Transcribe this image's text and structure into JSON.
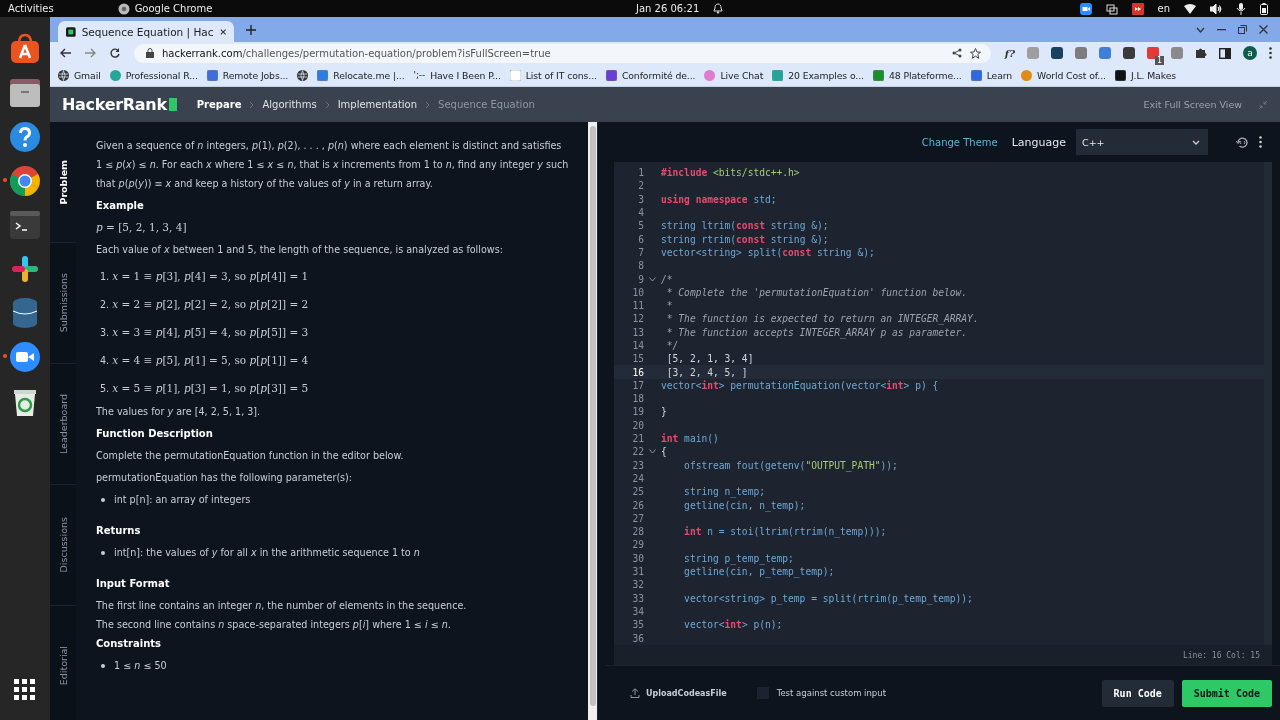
{
  "top_bar": {
    "activities": "Activities",
    "app": "Google Chrome",
    "clock": "Jan 26  06:21",
    "lang": "en"
  },
  "dock": [
    {
      "kind": "store",
      "running": false
    },
    {
      "kind": "files",
      "running": false
    },
    {
      "kind": "help",
      "running": false
    },
    {
      "kind": "browser",
      "running": true
    },
    {
      "kind": "terminal",
      "running": false
    },
    {
      "kind": "pinwheel",
      "running": false
    },
    {
      "kind": "database",
      "running": false
    },
    {
      "kind": "video",
      "running": true
    },
    {
      "kind": "trash",
      "running": false
    },
    {
      "kind": "apps",
      "running": false
    }
  ],
  "browser": {
    "tab": {
      "title": "Sequence Equation | Hac",
      "selected": true
    },
    "url_host": "hackerrank.com",
    "url_path": "/challenges/permutation-equation/problem?isFullScreen=true",
    "extensions": [
      {
        "kind": "text",
        "text": "f?",
        "color": "#333333"
      },
      {
        "kind": "icon",
        "color": "#9e9e9e"
      },
      {
        "kind": "icon",
        "color": "#17415f"
      },
      {
        "kind": "icon",
        "color": "#7d7d7d"
      },
      {
        "kind": "icon",
        "color": "#3f7fd8"
      },
      {
        "kind": "icon",
        "color": "#3a3a3a"
      },
      {
        "kind": "badge",
        "color": "#e53935",
        "text": "1"
      },
      {
        "kind": "icon",
        "color": "#8a8a8a"
      }
    ],
    "avatar": "a",
    "bookmarks": [
      {
        "kind": "globe",
        "color": "#333333",
        "label": "Gmail"
      },
      {
        "kind": "dot",
        "color": "#26a69a",
        "label": "Professional R..."
      },
      {
        "kind": "square",
        "color": "#3f6fd6",
        "label": "Remote Jobs..."
      },
      {
        "kind": "globe",
        "color": "#333333"
      },
      {
        "kind": "square",
        "color": "#2f7de1",
        "label": "Relocate.me |..."
      },
      {
        "kind": "text",
        "icon_text": "';--",
        "label": "Have I Been P..."
      },
      {
        "kind": "square",
        "color": "#ffffff",
        "label": "List of IT cons..."
      },
      {
        "kind": "square",
        "color": "#6a3fd0",
        "label": "Conformité de..."
      },
      {
        "kind": "dot",
        "color": "#e07bd1",
        "label": "Live Chat"
      },
      {
        "kind": "square",
        "color": "#22a59a",
        "label": "20 Examples o..."
      },
      {
        "kind": "square",
        "color": "#1a8f2e",
        "label": "48 Plateforme..."
      },
      {
        "kind": "square",
        "color": "#2f68e0",
        "label": "Learn"
      },
      {
        "kind": "dot",
        "color": "#e08a1a",
        "label": "World Cost of..."
      },
      {
        "kind": "square",
        "color": "#111111",
        "label": "J.L. Makes"
      }
    ]
  },
  "site": {
    "logo": "HackerRank",
    "breadcrumb": [
      {
        "label": "Prepare",
        "current": false
      },
      {
        "label": "Algorithms",
        "current": false
      },
      {
        "label": "Implementation",
        "current": false
      },
      {
        "label": "Sequence Equation",
        "current": true
      }
    ],
    "exit": "Exit Full Screen View"
  },
  "side_tabs": [
    {
      "label": "Problem",
      "selected": true
    },
    {
      "label": "Submissions",
      "selected": false
    },
    {
      "label": "Leaderboard",
      "selected": false
    },
    {
      "label": "Discussions",
      "selected": false
    },
    {
      "label": "Editorial",
      "selected": false
    }
  ],
  "problem": [
    {
      "kind": "para",
      "text": "Given a sequence of *n* integers, *p*(1), *p*(2), . . . , *p*(*n*) where each element is distinct and satisfies 1 ≤ *p*(*x*) ≤ *n*. For each *x* where 1 ≤ *x* ≤ *n*, that is *x* increments from 1 to *n*, find any integer *y* such that *p*(*p*(*y*)) ≡ *x* and keep a history of the values of *y* in a return array."
    },
    {
      "kind": "heading",
      "text": "Example"
    },
    {
      "kind": "math",
      "text": "*p* = [5, 2, 1, 3, 4]"
    },
    {
      "kind": "para",
      "text": "Each value of *x* between 1 and 5, the length of the sequence, is analyzed as follows:"
    },
    {
      "kind": "numbered",
      "number": "1.",
      "text": "*x* = 1 ≡ *p*[3], *p*[4] = 3, so *p*[*p*[4]] = 1"
    },
    {
      "kind": "numbered",
      "number": "2.",
      "text": "*x* = 2 ≡ *p*[2], *p*[2] = 2, so *p*[*p*[2]] = 2"
    },
    {
      "kind": "numbered",
      "number": "3.",
      "text": "*x* = 3 ≡ *p*[4], *p*[5] = 4, so *p*[*p*[5]] = 3"
    },
    {
      "kind": "numbered",
      "number": "4.",
      "text": "*x* = 4 ≡ *p*[5], *p*[1] = 5, so *p*[*p*[1]] = 4"
    },
    {
      "kind": "numbered",
      "number": "5.",
      "text": "*x* = 5 ≡ *p*[1], *p*[3] = 1, so *p*[*p*[3]] = 5"
    },
    {
      "kind": "para",
      "text": "The values for *y* are [4, 2, 5, 1, 3]."
    },
    {
      "kind": "heading",
      "text": "Function Description"
    },
    {
      "kind": "para",
      "text": "Complete the permutationEquation function in the editor below."
    },
    {
      "kind": "para",
      "text": "permutationEquation has the following parameter(s):"
    },
    {
      "kind": "bullet",
      "text": "int p[n]: an array of integers"
    },
    {
      "kind": "heading",
      "text": "Returns"
    },
    {
      "kind": "bullet",
      "text": "int[n]: the values of *y* for all *x* in the arithmetic sequence 1 to *n*"
    },
    {
      "kind": "heading",
      "text": "Input Format"
    },
    {
      "kind": "line",
      "text": "The first line contains an integer *n*, the number of elements in the sequence."
    },
    {
      "kind": "line",
      "text": "The second line contains *n* space-separated integers *p*[*i*] where 1 ≤ *i* ≤ *n*."
    },
    {
      "kind": "heading",
      "text": "Constraints"
    },
    {
      "kind": "bullet",
      "text": "1 ≤ *n* ≤ 50"
    }
  ],
  "editor": {
    "change_theme": "Change Theme",
    "language_label": "Language",
    "language": "C++",
    "lines": [
      {
        "n": "1",
        "selected": false,
        "fold": false,
        "tokens": [
          {
            "kind": "kw",
            "text": "#include "
          },
          {
            "kind": "str",
            "text": "<bits/stdc++.h>"
          }
        ]
      },
      {
        "n": "2",
        "selected": false,
        "fold": false
      },
      {
        "n": "3",
        "selected": false,
        "fold": false,
        "tokens": [
          {
            "kind": "kw",
            "text": "using namespace"
          },
          {
            "kind": "id",
            "text": " std;"
          }
        ]
      },
      {
        "n": "4",
        "selected": false,
        "fold": false
      },
      {
        "n": "5",
        "selected": false,
        "fold": false,
        "tokens": [
          {
            "kind": "id",
            "text": "string ltrim("
          },
          {
            "kind": "kw",
            "text": "const"
          },
          {
            "kind": "id",
            "text": " string &);"
          }
        ]
      },
      {
        "n": "6",
        "selected": false,
        "fold": false,
        "tokens": [
          {
            "kind": "id",
            "text": "string rtrim("
          },
          {
            "kind": "kw",
            "text": "const"
          },
          {
            "kind": "id",
            "text": " string &);"
          }
        ]
      },
      {
        "n": "7",
        "selected": false,
        "fold": false,
        "tokens": [
          {
            "kind": "id",
            "text": "vector<string> split("
          },
          {
            "kind": "kw",
            "text": "const"
          },
          {
            "kind": "id",
            "text": " string &);"
          }
        ]
      },
      {
        "n": "8",
        "selected": false,
        "fold": false
      },
      {
        "n": "9",
        "selected": false,
        "fold": true,
        "tokens": [
          {
            "kind": "cm",
            "text": "/*"
          }
        ]
      },
      {
        "n": "10",
        "selected": false,
        "fold": false,
        "tokens": [
          {
            "kind": "cm",
            "text": " * Complete the 'permutationEquation' function below."
          }
        ]
      },
      {
        "n": "11",
        "selected": false,
        "fold": false,
        "tokens": [
          {
            "kind": "cm",
            "text": " *"
          }
        ]
      },
      {
        "n": "12",
        "selected": false,
        "fold": false,
        "tokens": [
          {
            "kind": "cm",
            "text": " * The function is expected to return an INTEGER_ARRAY."
          }
        ]
      },
      {
        "n": "13",
        "selected": false,
        "fold": false,
        "tokens": [
          {
            "kind": "cm",
            "text": " * The function accepts INTEGER_ARRAY p as parameter."
          }
        ]
      },
      {
        "n": "14",
        "selected": false,
        "fold": false,
        "tokens": [
          {
            "kind": "cm",
            "text": " */"
          }
        ]
      },
      {
        "n": "15",
        "selected": false,
        "fold": false,
        "tokens": [
          {
            "kind": "pl",
            "text": " [5, 2, 1, 3, 4]"
          }
        ]
      },
      {
        "n": "16",
        "selected": true,
        "fold": false,
        "tokens": [
          {
            "kind": "pl",
            "text": " [3, 2, 4, 5, ]"
          }
        ]
      },
      {
        "n": "17",
        "selected": false,
        "fold": false,
        "tokens": [
          {
            "kind": "id",
            "text": "vector<"
          },
          {
            "kind": "kw",
            "text": "int"
          },
          {
            "kind": "id",
            "text": "> permutationEquation(vector<"
          },
          {
            "kind": "kw",
            "text": "int"
          },
          {
            "kind": "id",
            "text": "> p) {"
          }
        ]
      },
      {
        "n": "18",
        "selected": false,
        "fold": false
      },
      {
        "n": "19",
        "selected": false,
        "fold": false,
        "tokens": [
          {
            "kind": "pl",
            "text": "}"
          }
        ]
      },
      {
        "n": "20",
        "selected": false,
        "fold": false
      },
      {
        "n": "21",
        "selected": false,
        "fold": false,
        "tokens": [
          {
            "kind": "kw",
            "text": "int"
          },
          {
            "kind": "id",
            "text": " main()"
          }
        ]
      },
      {
        "n": "22",
        "selected": false,
        "fold": true,
        "tokens": [
          {
            "kind": "pl",
            "text": "{"
          }
        ]
      },
      {
        "n": "23",
        "selected": false,
        "fold": false,
        "tokens": [
          {
            "kind": "id",
            "text": "    ofstream fout(getenv("
          },
          {
            "kind": "str",
            "text": "\"OUTPUT_PATH\""
          },
          {
            "kind": "id",
            "text": "));"
          }
        ]
      },
      {
        "n": "24",
        "selected": false,
        "fold": false
      },
      {
        "n": "25",
        "selected": false,
        "fold": false,
        "tokens": [
          {
            "kind": "id",
            "text": "    string n_temp;"
          }
        ]
      },
      {
        "n": "26",
        "selected": false,
        "fold": false,
        "tokens": [
          {
            "kind": "id",
            "text": "    getline(cin, n_temp);"
          }
        ]
      },
      {
        "n": "27",
        "selected": false,
        "fold": false
      },
      {
        "n": "28",
        "selected": false,
        "fold": false,
        "tokens": [
          {
            "kind": "kw",
            "text": "    int"
          },
          {
            "kind": "id",
            "text": " n = stoi(ltrim(rtrim(n_temp)));"
          }
        ]
      },
      {
        "n": "29",
        "selected": false,
        "fold": false
      },
      {
        "n": "30",
        "selected": false,
        "fold": false,
        "tokens": [
          {
            "kind": "id",
            "text": "    string p_temp_temp;"
          }
        ]
      },
      {
        "n": "31",
        "selected": false,
        "fold": false,
        "tokens": [
          {
            "kind": "id",
            "text": "    getline(cin, p_temp_temp);"
          }
        ]
      },
      {
        "n": "32",
        "selected": false,
        "fold": false
      },
      {
        "n": "33",
        "selected": false,
        "fold": false,
        "tokens": [
          {
            "kind": "id",
            "text": "    vector<string> p_temp = split(rtrim(p_temp_temp));"
          }
        ]
      },
      {
        "n": "34",
        "selected": false,
        "fold": false
      },
      {
        "n": "35",
        "selected": false,
        "fold": false,
        "tokens": [
          {
            "kind": "id",
            "text": "    vector<"
          },
          {
            "kind": "kw",
            "text": "int"
          },
          {
            "kind": "id",
            "text": "> p(n);"
          }
        ]
      },
      {
        "n": "36",
        "selected": false,
        "fold": false
      }
    ],
    "status": "Line: 16 Col: 15"
  },
  "footer": {
    "upload": "UploadCodeasFile",
    "custom_input": {
      "label": "Test against custom input",
      "checked": false
    },
    "run": "Run Code",
    "submit": "Submit Code"
  }
}
